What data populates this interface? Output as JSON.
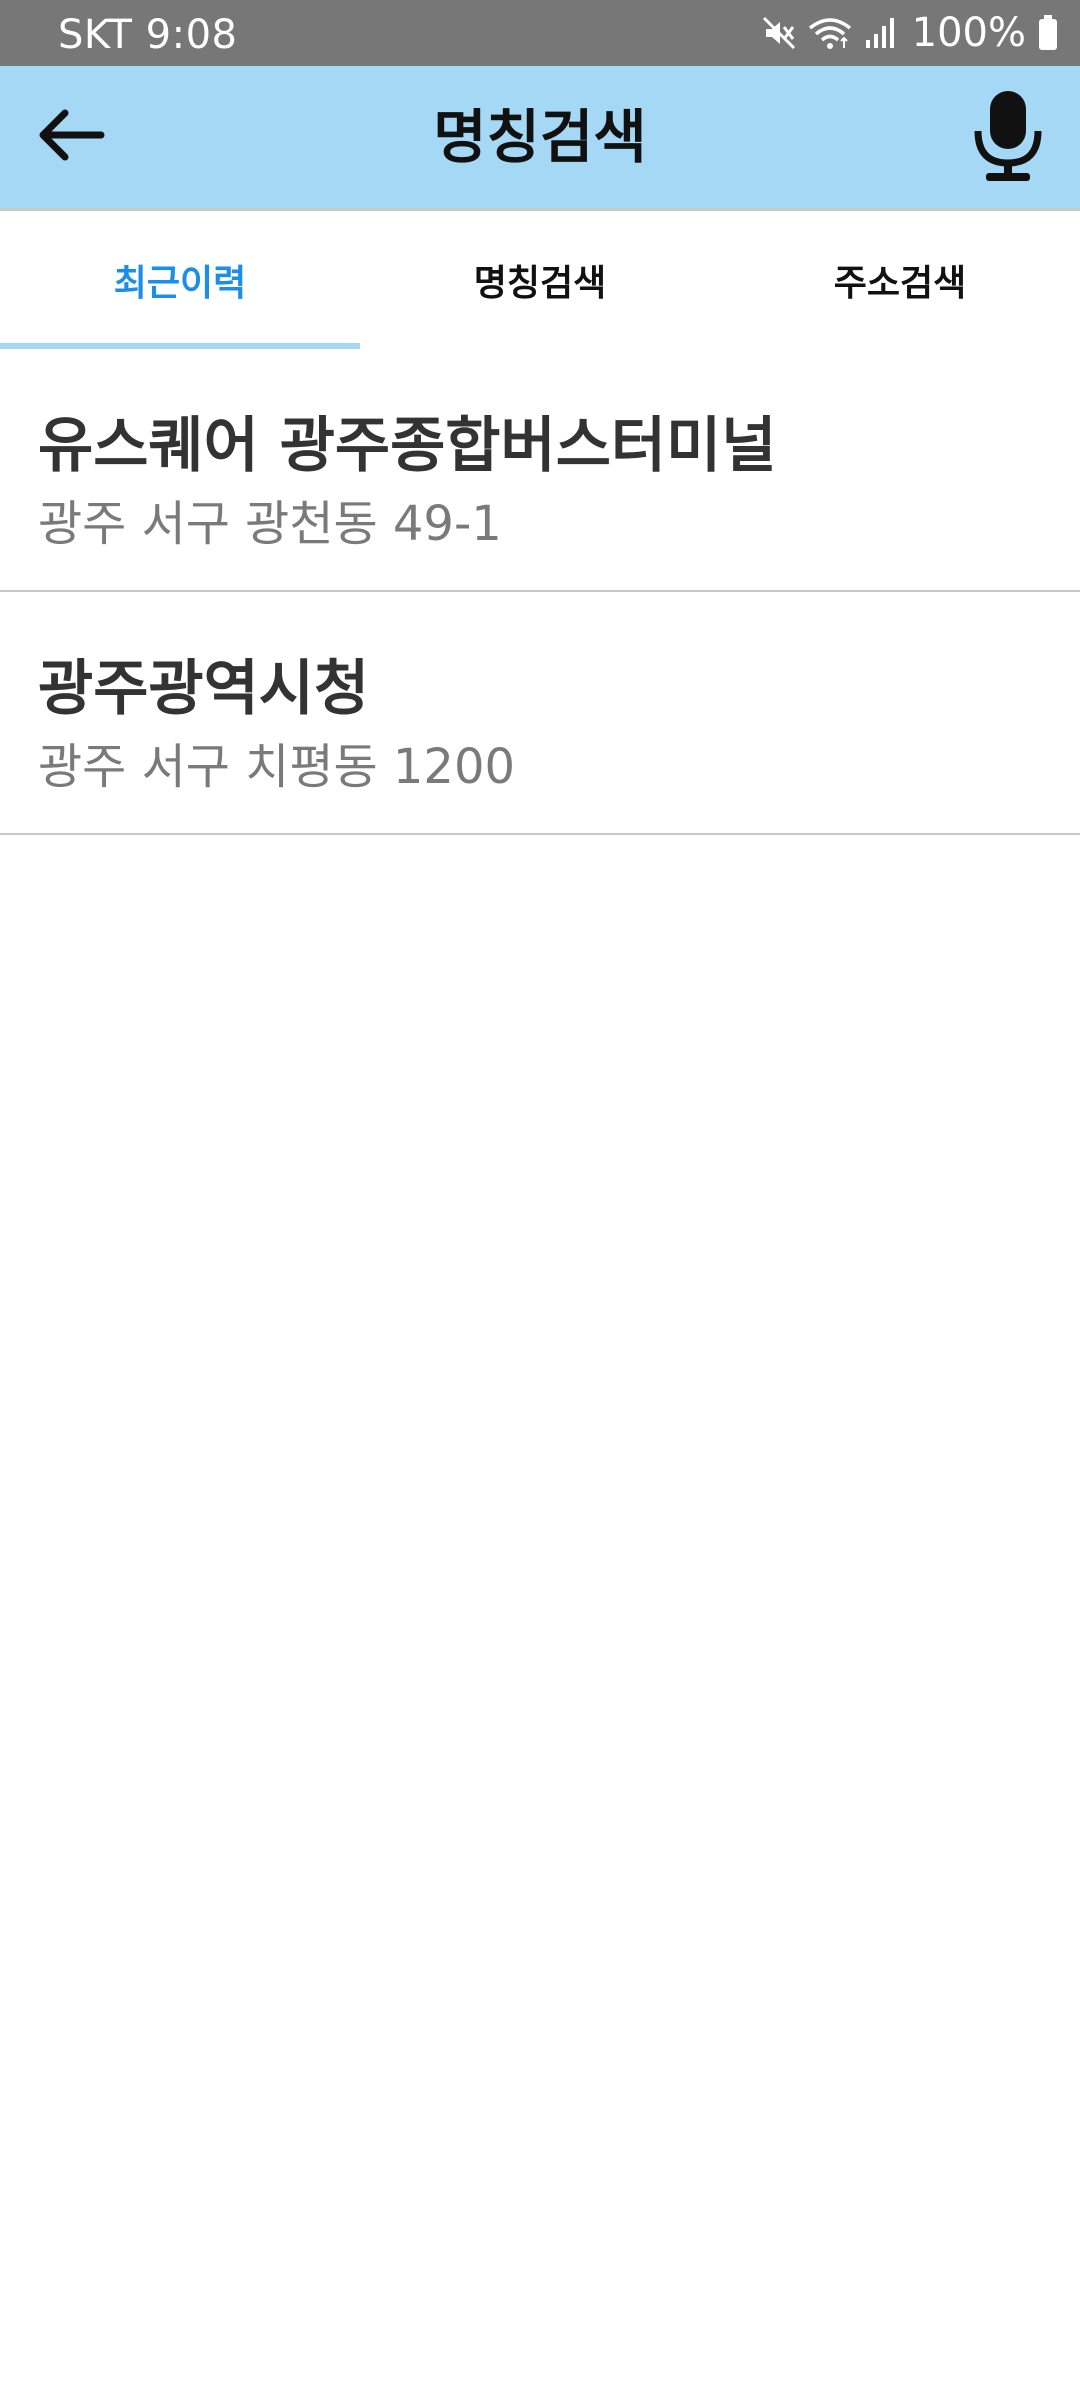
{
  "status_bar": {
    "carrier_time": "SKT 9:08",
    "battery": "100%"
  },
  "app_bar": {
    "title": "명칭검색",
    "icons": [
      "back-arrow-icon",
      "microphone-icon"
    ]
  },
  "tabs": [
    {
      "label": "최근이력",
      "active": true
    },
    {
      "label": "명칭검색",
      "active": false
    },
    {
      "label": "주소검색",
      "active": false
    }
  ],
  "recent_items": [
    {
      "name": "유스퀘어 광주종합버스터미널",
      "address": "광주 서구 광천동 49-1"
    },
    {
      "name": "광주광역시청",
      "address": "광주 서구 치평동 1200"
    }
  ],
  "colors": {
    "app_bar_bg": "#a4d8f5",
    "active_tab": "#1a8ee8",
    "status_bar_bg": "#777777"
  }
}
